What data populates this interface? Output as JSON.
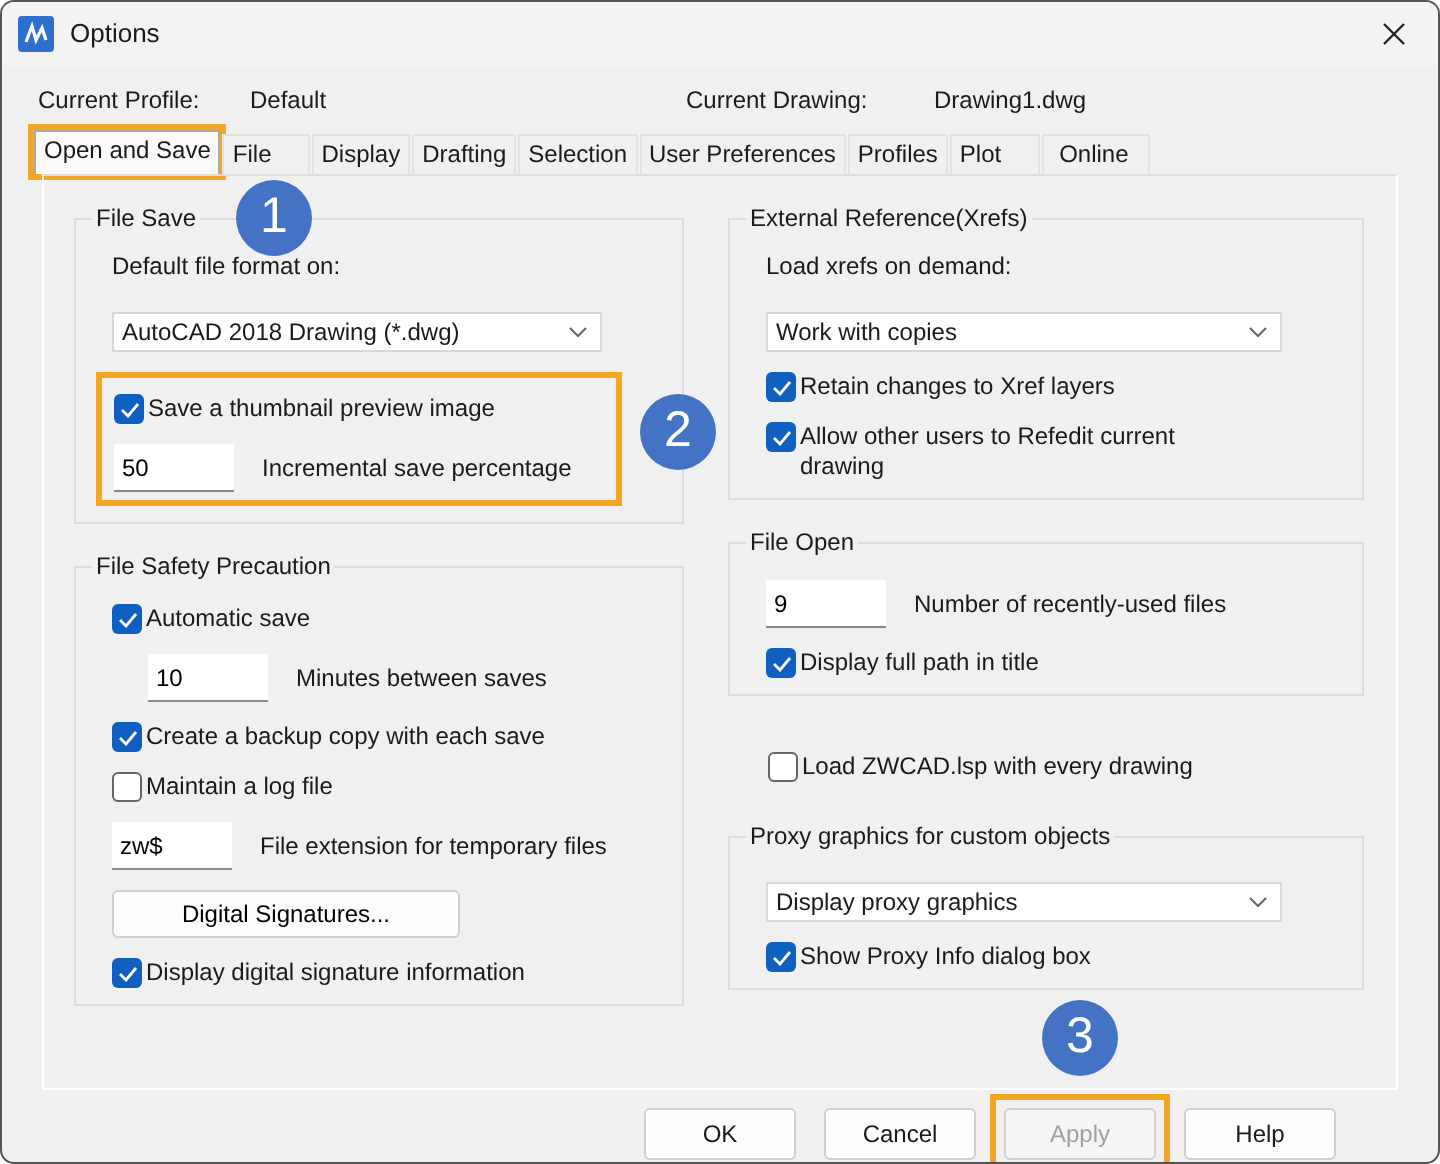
{
  "window": {
    "title": "Options"
  },
  "profile": {
    "label": "Current Profile:",
    "value": "Default"
  },
  "drawing": {
    "label": "Current Drawing:",
    "value": "Drawing1.dwg"
  },
  "tabs": [
    {
      "label": "Open and Save",
      "selected": true,
      "highlighted": true
    },
    {
      "label": "File",
      "selected": false,
      "highlighted": false
    },
    {
      "label": "Display",
      "selected": false,
      "highlighted": false
    },
    {
      "label": "Drafting",
      "selected": false,
      "highlighted": false
    },
    {
      "label": "Selection",
      "selected": false,
      "highlighted": false
    },
    {
      "label": "User Preferences",
      "selected": false,
      "highlighted": false
    },
    {
      "label": "Profiles",
      "selected": false,
      "highlighted": false
    },
    {
      "label": "Plot",
      "selected": false,
      "highlighted": false
    },
    {
      "label": "Online",
      "selected": false,
      "highlighted": false
    }
  ],
  "left_column": [
    {
      "kind": "group",
      "title": "File Save",
      "callout": "1",
      "items": [
        {
          "kind": "label",
          "text": "Default file format on:"
        },
        {
          "kind": "select",
          "value": "AutoCAD 2018 Drawing (*.dwg)"
        },
        {
          "kind": "frame",
          "highlighted": true,
          "callout": "2",
          "items": [
            {
              "kind": "checkbox",
              "label": "Save a thumbnail preview image",
              "checked": true
            },
            {
              "kind": "number",
              "value": "50",
              "text": "Incremental save percentage"
            }
          ]
        }
      ]
    },
    {
      "kind": "group",
      "title": "File Safety Precaution",
      "items": [
        {
          "kind": "checkbox",
          "label": "Automatic save",
          "checked": true,
          "children": [
            {
              "kind": "number",
              "value": "10",
              "text": "Minutes between saves"
            }
          ]
        },
        {
          "kind": "checkbox",
          "label": "Create a backup copy with each save",
          "checked": true
        },
        {
          "kind": "checkbox",
          "label": "Maintain a log file",
          "checked": false
        },
        {
          "kind": "number",
          "value": "zw$",
          "text": "File extension for temporary files"
        },
        {
          "kind": "button",
          "label": "Digital Signatures..."
        },
        {
          "kind": "checkbox",
          "label": "Display digital signature information",
          "checked": true
        }
      ]
    }
  ],
  "right_column": [
    {
      "kind": "group",
      "title": "External Reference(Xrefs)",
      "items": [
        {
          "kind": "label",
          "text": "Load xrefs on demand:"
        },
        {
          "kind": "select",
          "value": "Work with copies"
        },
        {
          "kind": "checkbox",
          "label": "Retain changes to Xref layers",
          "checked": true
        },
        {
          "kind": "checkbox",
          "label": "Allow other users to Refedit current drawing",
          "checked": true
        }
      ]
    },
    {
      "kind": "group",
      "title": "File Open",
      "items": [
        {
          "kind": "number",
          "value": "9",
          "text": "Number of recently-used files"
        },
        {
          "kind": "checkbox",
          "label": "Display full path in title",
          "checked": true
        }
      ]
    },
    {
      "kind": "checkbox",
      "label": "Load ZWCAD.lsp with every drawing",
      "checked": false
    },
    {
      "kind": "group",
      "title": "Proxy graphics for custom objects",
      "items": [
        {
          "kind": "select",
          "value": "Display proxy graphics"
        },
        {
          "kind": "checkbox",
          "label": "Show Proxy Info dialog box",
          "checked": true
        }
      ]
    }
  ],
  "buttons": [
    {
      "label": "OK",
      "disabled": false,
      "highlighted": false
    },
    {
      "label": "Cancel",
      "disabled": false,
      "highlighted": false
    },
    {
      "label": "Apply",
      "disabled": true,
      "highlighted": true,
      "callout": "3"
    },
    {
      "label": "Help",
      "disabled": false,
      "highlighted": false
    }
  ]
}
